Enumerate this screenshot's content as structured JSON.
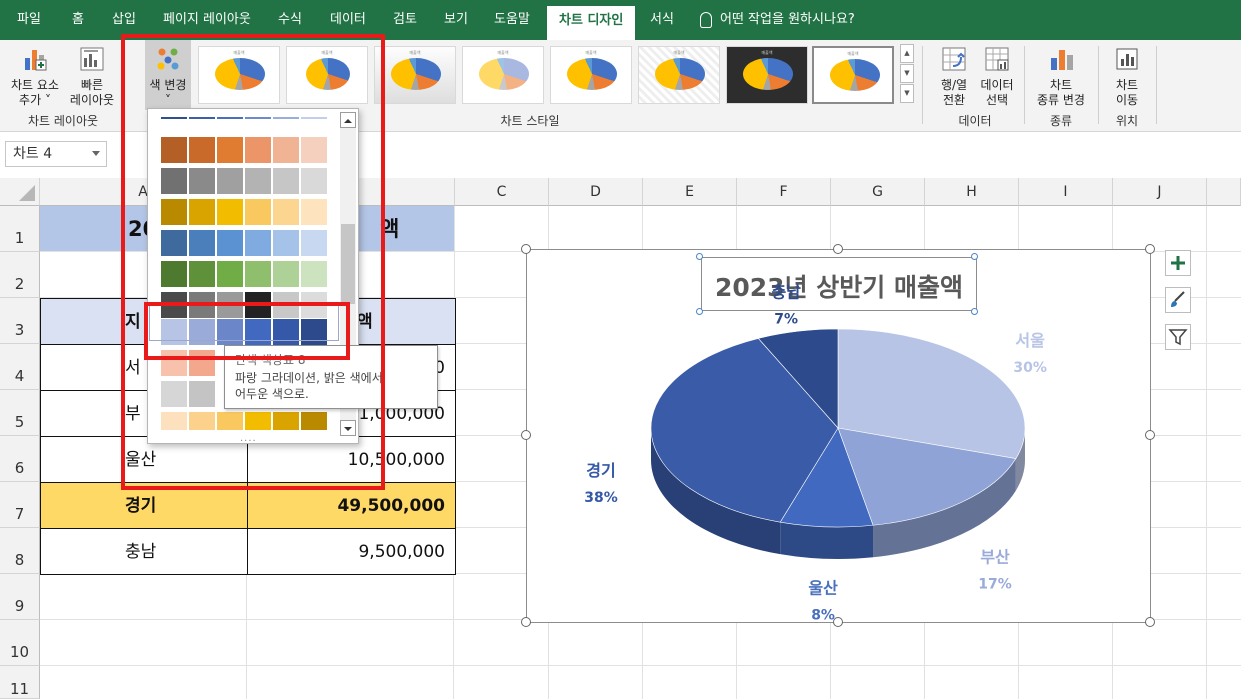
{
  "ribbon_tabs": [
    "파일",
    "홈",
    "삽입",
    "페이지 레이아웃",
    "수식",
    "데이터",
    "검토",
    "보기",
    "도움말",
    "차트 디자인",
    "서식"
  ],
  "tell_me": "어떤 작업을 원하시나요?",
  "ribbon": {
    "add_element_l1": "차트 요소",
    "add_element_l2": "추가",
    "quick_layout_l1": "빠른",
    "quick_layout_l2": "레이아웃",
    "layout_group": "차트 레이아웃",
    "change_colors": "색 변경",
    "styles_group": "차트 스타일",
    "switch_l1": "행/열",
    "switch_l2": "전환",
    "select_data_l1": "데이터",
    "select_data_l2": "선택",
    "data_group": "데이터",
    "change_type_l1": "차트",
    "change_type_l2": "종류 변경",
    "type_group": "종류",
    "move_l1": "차트",
    "move_l2": "이동",
    "location_group": "위치"
  },
  "name_box": "차트 4",
  "columns": [
    "A",
    "B",
    "C",
    "D",
    "E",
    "F",
    "G",
    "H",
    "I",
    "J"
  ],
  "rows": [
    "1",
    "2",
    "3",
    "4",
    "5",
    "6",
    "7",
    "8",
    "9",
    "10",
    "11"
  ],
  "sheet": {
    "r1_left": "20",
    "r1_right": "액",
    "r3_left": "지",
    "r3_right": "액",
    "r4_left": "서",
    "r4_right": "0",
    "r5_left": "부",
    "r5_right": "21,000,000",
    "r6_name": "울산",
    "r6_value": "10,500,000",
    "r7_name": "경기",
    "r7_value": "49,500,000",
    "r8_name": "충남",
    "r8_value": "9,500,000"
  },
  "palette": {
    "rows": [
      [
        "#2f4f8f",
        "#3e5fa6",
        "#4a70bd",
        "#6d8bcb",
        "#98add9",
        "#c3cfea"
      ],
      [
        "#b45f26",
        "#c96a2a",
        "#e07b32",
        "#eb9568",
        "#f0b394",
        "#f5d0be"
      ],
      [
        "#717171",
        "#8a8a8a",
        "#a0a0a0",
        "#b3b3b3",
        "#c6c6c6",
        "#d9d9d9"
      ],
      [
        "#b98a00",
        "#d9a300",
        "#f2bc00",
        "#f9c85f",
        "#fcd690",
        "#fde4be"
      ],
      [
        "#3e6a9e",
        "#4a7fbb",
        "#5b93d2",
        "#80abe0",
        "#a5c3e8",
        "#c7d8f0"
      ],
      [
        "#4d7a2e",
        "#5e9139",
        "#70ad47",
        "#8fbf6d",
        "#aed197",
        "#cde2bf"
      ],
      [
        "#4a4a4a",
        "#7a7a7a",
        "#9a9a9a",
        "#232323",
        "#c8c8c8",
        "#dcdcdc"
      ],
      [
        "#b8c4e6",
        "#9aabd9",
        "#6b86c9",
        "#4169c0",
        "#3558a8",
        "#2d4a8c"
      ],
      [
        "#f8c1ac",
        "#f3a88d",
        "#ffffff",
        "#ffffff",
        "#ffffff",
        "#ffffff"
      ],
      [
        "#d6d6d6",
        "#c4c4c4",
        "#ffffff",
        "#ffffff",
        "#ffffff",
        "#ffffff"
      ],
      [
        "#fde1bf",
        "#fcd18c",
        "#f9c85f",
        "#f2bc00",
        "#d9a300",
        "#b98a00"
      ]
    ]
  },
  "tooltip": {
    "title": "단색 색상표 8",
    "line1": "파랑 그라데이션, 밝은 색에서",
    "line2": "어두운 색으로."
  },
  "chart_data": {
    "type": "pie",
    "title": "2023년 상반기 매출액",
    "categories": [
      "서울",
      "부산",
      "울산",
      "경기",
      "충남"
    ],
    "values": [
      30,
      17,
      8,
      38,
      7
    ],
    "labels": [
      "30%",
      "17%",
      "8%",
      "38%",
      "7%"
    ],
    "colors": [
      "#b8c4e6",
      "#8fa3d6",
      "#4169c0",
      "#3a5ba8",
      "#2d4a8c"
    ],
    "label_colors": [
      "#b8c4e6",
      "#9aabd9",
      "#4a70bd",
      "#3558a8",
      "#2d4a8c"
    ]
  }
}
